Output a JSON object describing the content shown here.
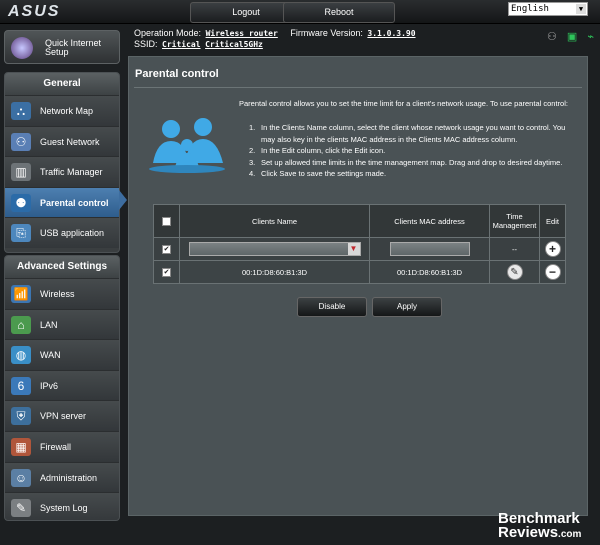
{
  "brand": "ASUS",
  "header": {
    "logout_label": "Logout",
    "reboot_label": "Reboot",
    "language": "English"
  },
  "info": {
    "op_mode_label": "Operation Mode:",
    "op_mode_value": "Wireless router",
    "firmware_label": "Firmware Version:",
    "firmware_value": "3.1.0.3.90",
    "ssid_label": "SSID:",
    "ssid_1": "Critical",
    "ssid_2": "Critical5GHz"
  },
  "quick_setup_label": "Quick Internet Setup",
  "general": {
    "title": "General",
    "items": [
      {
        "label": "Network Map",
        "icon": "network-map-icon",
        "glyph": "⛬"
      },
      {
        "label": "Guest Network",
        "icon": "guest-network-icon",
        "glyph": "⚇"
      },
      {
        "label": "Traffic Manager",
        "icon": "traffic-manager-icon",
        "glyph": "▥"
      },
      {
        "label": "Parental control",
        "icon": "parental-control-icon",
        "glyph": "⚉"
      },
      {
        "label": "USB application",
        "icon": "usb-application-icon",
        "glyph": "⎘"
      }
    ]
  },
  "advanced": {
    "title": "Advanced Settings",
    "items": [
      {
        "label": "Wireless",
        "icon": "wireless-icon",
        "glyph": "📶"
      },
      {
        "label": "LAN",
        "icon": "lan-icon",
        "glyph": "⌂"
      },
      {
        "label": "WAN",
        "icon": "wan-icon",
        "glyph": "◍"
      },
      {
        "label": "IPv6",
        "icon": "ipv6-icon",
        "glyph": "6"
      },
      {
        "label": "VPN server",
        "icon": "vpn-server-icon",
        "glyph": "⛨"
      },
      {
        "label": "Firewall",
        "icon": "firewall-icon",
        "glyph": "▦"
      },
      {
        "label": "Administration",
        "icon": "administration-icon",
        "glyph": "☺"
      },
      {
        "label": "System Log",
        "icon": "system-log-icon",
        "glyph": "✎"
      }
    ]
  },
  "main": {
    "title": "Parental control",
    "intro": "Parental control allows you to set the time limit for a client's network usage. To use parental control:",
    "steps": [
      {
        "num": "1.",
        "text": "In the Clients Name column, select the client whose network usage you want to control. You may also key in the clients MAC address in the Clients MAC address column."
      },
      {
        "num": "2.",
        "text": "In the Edit column, click the Edit icon."
      },
      {
        "num": "3.",
        "text": "Set up allowed time limits in the time management map. Drag and drop to desired daytime."
      },
      {
        "num": "4.",
        "text": "Click Save to save the settings made."
      }
    ],
    "table": {
      "headers": {
        "name": "Clients Name",
        "mac": "Clients MAC address",
        "time": "Time Management",
        "edit": "Edit"
      },
      "new_row_time": "--",
      "rows": [
        {
          "name": "00:1D:D8:60:B1:3D",
          "mac": "00:1D:D8:60:B1:3D"
        }
      ]
    },
    "disable_label": "Disable",
    "apply_label": "Apply"
  },
  "watermark": {
    "line1": "Benchmark",
    "line2": "Reviews",
    "suffix": ".com"
  },
  "colors": {
    "active_nav": "#3d6d9f",
    "background": "#1c1f21",
    "panel": "#4a5255"
  }
}
